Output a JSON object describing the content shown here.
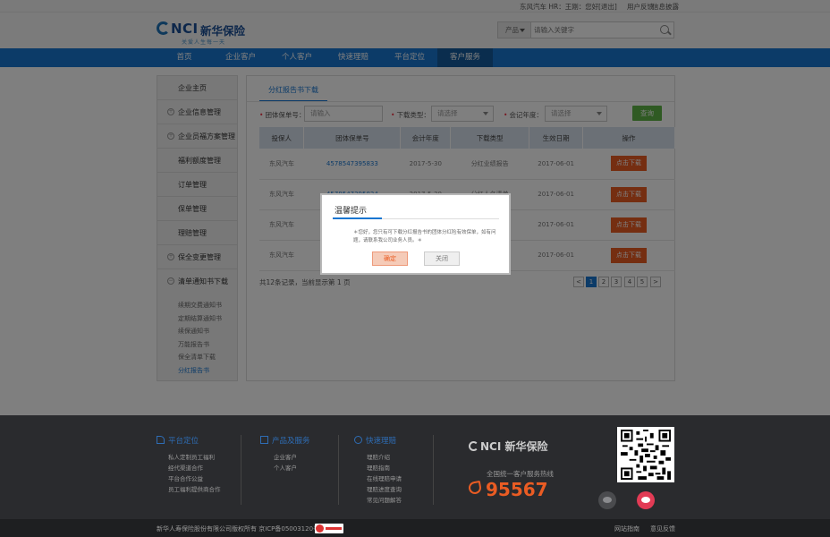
{
  "topbar": {
    "user": "东风汽车 HR：王刚：您好",
    "logout": "[退出]",
    "feedback": "用户反馈",
    "messages": "信息披露"
  },
  "brand": {
    "logo_en": "NCI",
    "logo_cn": "新华保险",
    "slogan": "关爱人生每一天"
  },
  "search": {
    "category": "产品",
    "placeholder": "请输入关键字"
  },
  "nav": {
    "items": [
      "首页",
      "企业客户",
      "个人客户",
      "快速理赔",
      "平台定位",
      "客户服务"
    ],
    "active_index": 5
  },
  "sidebar": {
    "menu": [
      {
        "label": "企业主页",
        "icon": false
      },
      {
        "label": "企业信息管理",
        "icon": true
      },
      {
        "label": "企业员福方案管理",
        "icon": true
      },
      {
        "label": "福利额度管理",
        "icon": false
      },
      {
        "label": "订单管理",
        "icon": false
      },
      {
        "label": "保单管理",
        "icon": false
      },
      {
        "label": "理赔管理",
        "icon": false
      },
      {
        "label": "保全变更管理",
        "icon": true
      },
      {
        "label": "清单通知书下载",
        "icon": true
      }
    ],
    "submenu": [
      "续期交费通知书",
      "定期结算通知书",
      "续保通知书",
      "万能报告书",
      "保全清单下载",
      "分红报告书"
    ],
    "submenu_active": 5
  },
  "content": {
    "tab": "分红报告书下载",
    "filters": {
      "group_no_label": "团体保单号：",
      "group_no_placeholder": "请输入",
      "type_label": "下载类型：",
      "type_placeholder": "请选择",
      "year_label": "会记年度：",
      "year_placeholder": "请选择",
      "query_button": "查询"
    },
    "table": {
      "headers": [
        "投保人",
        "团体保单号",
        "会计年度",
        "下载类型",
        "生效日期",
        "操作"
      ],
      "rows": [
        [
          "东风汽车",
          "4578547395833",
          "2017-5-30",
          "分红业绩报告",
          "2017-06-01",
          "点击下载"
        ],
        [
          "东风汽车",
          "4578547395834",
          "2017-5-30",
          "分红人名清单",
          "2017-06-01",
          "点击下载"
        ],
        [
          "东风汽车",
          "",
          "",
          "",
          "2017-06-01",
          "点击下载"
        ],
        [
          "东风汽车",
          "",
          "",
          "",
          "2017-06-01",
          "点击下载"
        ]
      ]
    },
    "pagination": {
      "info": "共12条记录，当前显示第 1 页",
      "pages": [
        "<",
        "1",
        "2",
        "3",
        "4",
        "5",
        ">"
      ],
      "current": "1"
    }
  },
  "dialog": {
    "title": "温馨提示",
    "message": "＊您好，您只有可下载分红报告书的团体分红险有效保单，如有问题，请联系我公司业务人员。＊",
    "confirm": "确定",
    "close": "关闭"
  },
  "footer": {
    "col1": {
      "title": "平台定位",
      "links": [
        "私人定制员工福利",
        "经代渠道合作",
        "平台合作公益",
        "员工福利提供商合作"
      ]
    },
    "col2": {
      "title": "产品及服务",
      "links": [
        "企业客户",
        "个人客户"
      ]
    },
    "col3": {
      "title": "快速理赔",
      "links": [
        "理赔介绍",
        "理赔指南",
        "在线理赔申请",
        "理赔进度查询",
        "常见问题解答"
      ]
    },
    "logo_en": "NCI",
    "logo_cn": "新华保险",
    "hotline_title": "全国统一客户服务热线",
    "hotline": "95567",
    "copyright": "新华人寿保险股份有限公司版权所有 京ICP备05003120号",
    "links": [
      "网站指南",
      "意见反馈"
    ]
  },
  "colors": {
    "nav_blue": "#1976d0",
    "accent_orange": "#ea5c23",
    "query_green": "#5fb546"
  }
}
